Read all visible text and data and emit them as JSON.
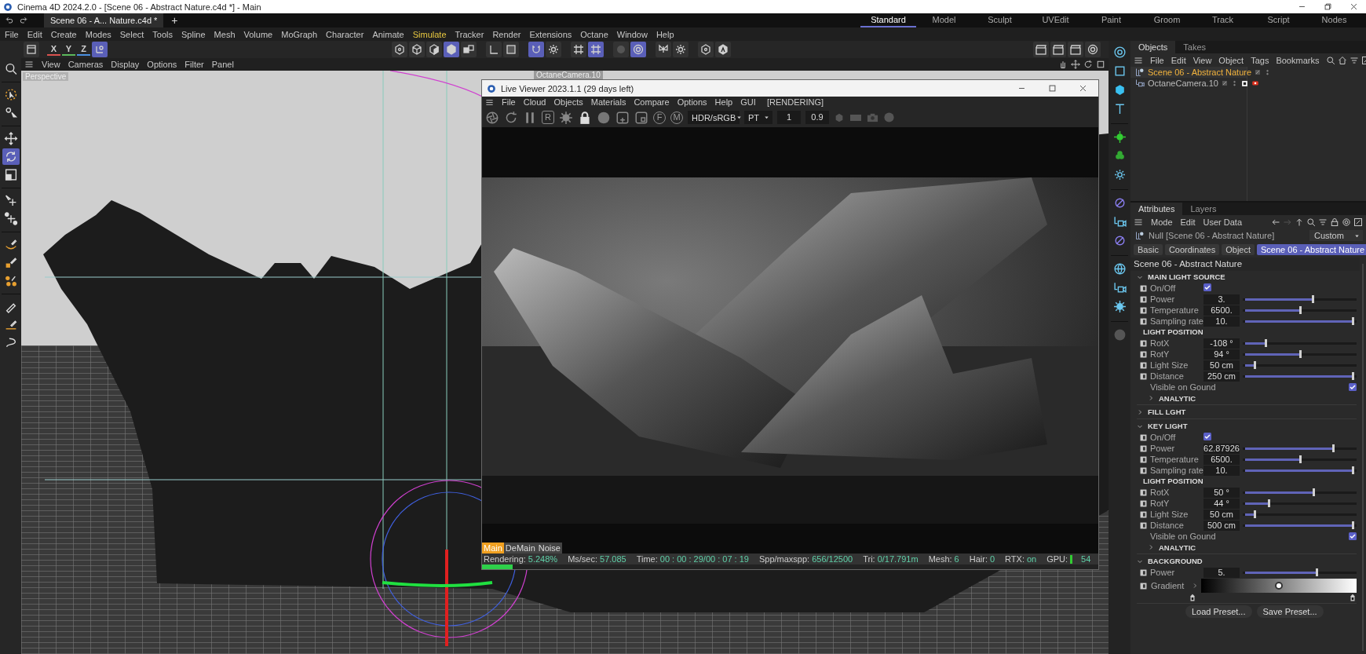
{
  "window": {
    "title": "Cinema 4D 2024.2.0 - [Scene 06 - Abstract Nature.c4d *] - Main"
  },
  "document_tabs": [
    {
      "label": "Scene 06 - A... Nature.c4d *",
      "selected": true
    }
  ],
  "new_tab": "+",
  "layouts": [
    {
      "label": "Standard",
      "selected": true
    },
    {
      "label": "Model",
      "selected": false
    },
    {
      "label": "Sculpt",
      "selected": false
    },
    {
      "label": "UVEdit",
      "selected": false
    },
    {
      "label": "Paint",
      "selected": false
    },
    {
      "label": "Groom",
      "selected": false
    },
    {
      "label": "Track",
      "selected": false
    },
    {
      "label": "Script",
      "selected": false
    },
    {
      "label": "Nodes",
      "selected": false
    }
  ],
  "menu": [
    {
      "label": "File",
      "highlighted": false
    },
    {
      "label": "Edit",
      "highlighted": false
    },
    {
      "label": "Create",
      "highlighted": false
    },
    {
      "label": "Modes",
      "highlighted": false
    },
    {
      "label": "Select",
      "highlighted": false
    },
    {
      "label": "Tools",
      "highlighted": false
    },
    {
      "label": "Spline",
      "highlighted": false
    },
    {
      "label": "Mesh",
      "highlighted": false
    },
    {
      "label": "Volume",
      "highlighted": false
    },
    {
      "label": "MoGraph",
      "highlighted": false
    },
    {
      "label": "Character",
      "highlighted": false
    },
    {
      "label": "Animate",
      "highlighted": false
    },
    {
      "label": "Simulate",
      "highlighted": true
    },
    {
      "label": "Tracker",
      "highlighted": false
    },
    {
      "label": "Render",
      "highlighted": false
    },
    {
      "label": "Extensions",
      "highlighted": false
    },
    {
      "label": "Octane",
      "highlighted": false
    },
    {
      "label": "Window",
      "highlighted": false
    },
    {
      "label": "Help",
      "highlighted": false
    }
  ],
  "toolbar": {
    "axes": [
      {
        "label": "X",
        "color": "#d9534f"
      },
      {
        "label": "Y",
        "color": "#5cb85c"
      },
      {
        "label": "Z",
        "color": "#4a8fe0"
      }
    ],
    "tools": [
      {
        "selected": false
      },
      {
        "selected": true
      },
      {
        "selected": false
      },
      {
        "selected": false
      },
      {
        "selected": false
      },
      {
        "selected": true
      },
      {
        "selected": false
      },
      {
        "selected": false
      },
      {
        "selected": false
      },
      {
        "selected": true
      },
      {
        "selected": false
      },
      {
        "selected": false
      },
      {
        "selected": true
      },
      {
        "selected": false
      },
      {
        "selected": true
      },
      {
        "selected": false
      },
      {
        "selected": false
      },
      {
        "selected": false
      },
      {
        "selected": false
      },
      {
        "selected": false
      },
      {
        "selected": false
      },
      {
        "selected": false
      },
      {
        "selected": false
      }
    ]
  },
  "tools": [
    {
      "selected": false
    },
    {
      "selected": false
    },
    {
      "selected": false
    },
    {
      "selected": false
    },
    {
      "selected": true
    },
    {
      "selected": false
    },
    {
      "selected": false
    },
    {
      "selected": false
    },
    {
      "selected": false
    },
    {
      "selected": false
    },
    {
      "selected": false
    },
    {
      "selected": false
    },
    {
      "selected": false
    },
    {
      "selected": false
    }
  ],
  "viewport": {
    "menu": [
      "View",
      "Cameras",
      "Display",
      "Options",
      "Filter",
      "Panel"
    ],
    "camera_label": "Perspective",
    "object_label": "OctaneCamera.10"
  },
  "live_viewer": {
    "title": "Live Viewer 2023.1.1 (29 days left)",
    "menu": [
      "File",
      "Cloud",
      "Objects",
      "Materials",
      "Compare",
      "Options",
      "Help",
      "GUI"
    ],
    "status": "[RENDERING]",
    "letter_buttons": [
      "R",
      "F",
      "M"
    ],
    "color_space": "HDR/sRGB",
    "kernel": "PT",
    "field_1": "1",
    "field_2": "0.9",
    "passes": [
      {
        "label": "Main",
        "selected": true
      },
      {
        "label": "DeMain",
        "selected": false
      },
      {
        "label": "Noise",
        "selected": false
      }
    ],
    "stats": [
      {
        "kind": "text",
        "label": "Rendering:",
        "value": "5.248%"
      },
      {
        "kind": "text",
        "label": "Ms/sec:",
        "value": "57.085"
      },
      {
        "kind": "text",
        "label": "Time:",
        "value": "00 : 00 : 29/00 : 07 : 19"
      },
      {
        "kind": "text",
        "label": "Spp/maxspp:",
        "value": "656/12500"
      },
      {
        "kind": "text",
        "label": "Tri:",
        "value": "0/17.791m"
      },
      {
        "kind": "text",
        "label": "Mesh:",
        "value": "6"
      },
      {
        "kind": "text",
        "label": "Hair:",
        "value": "0"
      },
      {
        "kind": "text",
        "label": "RTX:",
        "value": "on"
      },
      {
        "kind": "meter",
        "label": "GPU:",
        "value": "54"
      }
    ],
    "progress": {
      "level": 0.05
    }
  },
  "objects_panel": {
    "tabs": [
      {
        "label": "Objects",
        "selected": true
      },
      {
        "label": "Takes",
        "selected": false
      }
    ],
    "menu": [
      "File",
      "Edit",
      "View",
      "Object",
      "Tags",
      "Bookmarks"
    ],
    "items": [
      {
        "kind": "null",
        "name": "Scene 06 - Abstract Nature",
        "selected": true
      },
      {
        "kind": "camera",
        "name": "OctaneCamera.10",
        "selected": false
      }
    ]
  },
  "attributes_panel": {
    "tabs": [
      {
        "label": "Attributes",
        "selected": true
      },
      {
        "label": "Layers",
        "selected": false
      }
    ],
    "menu": [
      "Mode",
      "Edit",
      "User Data"
    ],
    "object": "Null [Scene 06 - Abstract Nature]",
    "mode": "Custom",
    "page_tabs": [
      {
        "label": "Basic",
        "selected": false
      },
      {
        "label": "Coordinates",
        "selected": false
      },
      {
        "label": "Object",
        "selected": false
      },
      {
        "label": "Scene 06 - Abstract Nature",
        "selected": true
      }
    ],
    "heading": "Scene 06 - Abstract Nature",
    "sections": [
      {
        "title": "MAIN LIGHT SOURCE",
        "expanded": true,
        "rows": [
          {
            "kind": "check",
            "label": "On/Off",
            "checked": true
          },
          {
            "kind": "slider",
            "label": "Power",
            "value": "3.",
            "level": 0.63
          },
          {
            "kind": "slider",
            "label": "Temperature",
            "value": "6500.",
            "level": 0.52
          },
          {
            "kind": "slider",
            "label": "Sampling rate",
            "value": "10.",
            "level": 1
          },
          {
            "kind": "subhead",
            "label": "LIGHT POSITION"
          },
          {
            "kind": "slider",
            "label": "RotX",
            "value": "-108 °",
            "level": 0.2
          },
          {
            "kind": "slider",
            "label": "RotY",
            "value": "94 °",
            "level": 0.52
          },
          {
            "kind": "slider",
            "label": "Light Size",
            "value": "50 cm",
            "level": 0.1
          },
          {
            "kind": "slider",
            "label": "Distance",
            "value": "250 cm",
            "level": 1
          },
          {
            "kind": "inline-check",
            "label": "Visible on Gound",
            "checked": true
          },
          {
            "kind": "group",
            "label": "ANALYTIC",
            "expanded": false
          }
        ]
      },
      {
        "title": "FILL LGHT",
        "expanded": false
      },
      {
        "title": "KEY LIGHT",
        "expanded": true,
        "rows": [
          {
            "kind": "check",
            "label": "On/Off",
            "checked": true
          },
          {
            "kind": "slider",
            "label": "Power",
            "value": "62.87926",
            "level": 0.82
          },
          {
            "kind": "slider",
            "label": "Temperature",
            "value": "6500.",
            "level": 0.52
          },
          {
            "kind": "slider",
            "label": "Sampling rate",
            "value": "10.",
            "level": 1
          },
          {
            "kind": "subhead",
            "label": "LIGHT POSITION"
          },
          {
            "kind": "slider",
            "label": "RotX",
            "value": "50 °",
            "level": 0.64
          },
          {
            "kind": "slider",
            "label": "RotY",
            "value": "44 °",
            "level": 0.23
          },
          {
            "kind": "slider",
            "label": "Light Size",
            "value": "50 cm",
            "level": 0.1
          },
          {
            "kind": "slider",
            "label": "Distance",
            "value": "500 cm",
            "level": 1
          },
          {
            "kind": "inline-check",
            "label": "Visible on Gound",
            "checked": true
          },
          {
            "kind": "group",
            "label": "ANALYTIC",
            "expanded": false
          }
        ]
      },
      {
        "title": "BACKGROUND",
        "expanded": true,
        "rows": [
          {
            "kind": "slider",
            "label": "Power",
            "value": "5.",
            "level": 0.67
          },
          {
            "kind": "gradient",
            "label": "Gradient",
            "level": 0.5
          }
        ]
      }
    ],
    "buttons": [
      "Load Preset...",
      "Save Preset..."
    ]
  }
}
